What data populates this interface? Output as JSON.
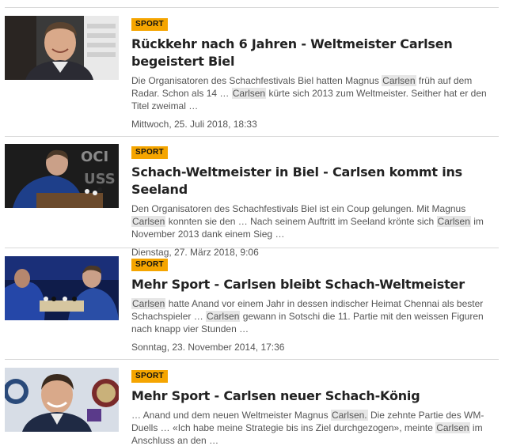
{
  "articles": [
    {
      "badge": "SPORT",
      "title": "Rückkehr nach 6 Jahren - Weltmeister Carlsen begeistert Biel",
      "teaser_parts": [
        {
          "t": "Die Organisatoren des Schachfestivals Biel hatten Magnus "
        },
        {
          "t": "Carlsen",
          "hl": true
        },
        {
          "t": " früh auf dem Radar. Schon als 14 … "
        },
        {
          "t": "Carlsen",
          "hl": true
        },
        {
          "t": " kürte sich 2013 zum Weltmeister. Seither hat er den Titel zweimal …"
        }
      ],
      "date": "Mittwoch, 25. Juli 2018, 18:33",
      "image": "magnus-carlsen-portrait"
    },
    {
      "badge": "SPORT",
      "title": "Schach-Weltmeister in Biel - Carlsen kommt ins Seeland",
      "teaser_parts": [
        {
          "t": "Den Organisatoren des Schachfestivals Biel ist ein Coup gelungen. Mit Magnus "
        },
        {
          "t": "Carlsen",
          "hl": true
        },
        {
          "t": " konnten sie den … Nach seinem Auftritt im Seeland krönte sich "
        },
        {
          "t": "Carlsen",
          "hl": true
        },
        {
          "t": " im November 2013 dank einem Sieg …"
        }
      ],
      "date": "Dienstag, 27. März 2018, 9:06",
      "image": "carlsen-at-chessboard"
    },
    {
      "badge": "SPORT",
      "title": "Mehr Sport - Carlsen bleibt Schach-Weltmeister",
      "teaser_parts": [
        {
          "t": "Carlsen",
          "hl": true
        },
        {
          "t": " hatte Anand vor einem Jahr in dessen indischer Heimat Chennai als bester Schachspieler … "
        },
        {
          "t": "Carlsen",
          "hl": true
        },
        {
          "t": " gewann in Sotschi die 11. Partie mit den weissen Figuren nach knapp vier Stunden …"
        }
      ],
      "date": "Sonntag, 23. November 2014, 17:36",
      "image": "anand-vs-carlsen-match"
    },
    {
      "badge": "SPORT",
      "title": "Mehr Sport - Carlsen neuer Schach-König",
      "teaser_parts": [
        {
          "t": "… Anand und dem neuen Weltmeister Magnus "
        },
        {
          "t": "Carlsen.",
          "hl": true
        },
        {
          "t": " Die zehnte Partie des WM-Duells … «Ich habe meine Strategie bis ins Ziel durchgezogen», meinte "
        },
        {
          "t": "Carlsen",
          "hl": true
        },
        {
          "t": " im Anschluss an den …"
        }
      ],
      "date": "",
      "image": "carlsen-smiling-fide"
    }
  ],
  "colors": {
    "badge": "#f5a500",
    "highlight": "#e6e6e6",
    "divider": "#d9d9d9"
  }
}
